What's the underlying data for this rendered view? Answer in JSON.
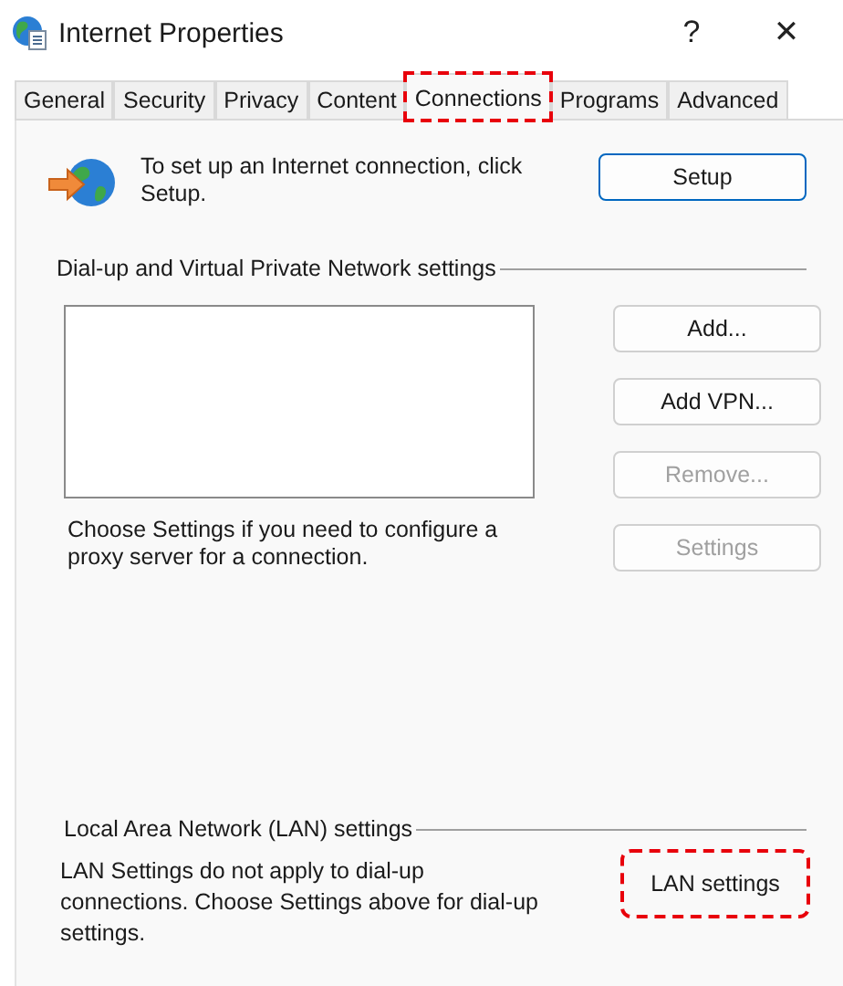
{
  "window": {
    "title": "Internet Properties",
    "help_button": "?",
    "close_button": "✕"
  },
  "tabs": [
    {
      "label": "General",
      "selected": false,
      "highlighted": false
    },
    {
      "label": "Security",
      "selected": false,
      "highlighted": false
    },
    {
      "label": "Privacy",
      "selected": false,
      "highlighted": false
    },
    {
      "label": "Content",
      "selected": false,
      "highlighted": false
    },
    {
      "label": "Connections",
      "selected": true,
      "highlighted": true
    },
    {
      "label": "Programs",
      "selected": false,
      "highlighted": false
    },
    {
      "label": "Advanced",
      "selected": false,
      "highlighted": false
    }
  ],
  "setup": {
    "text": "To set up an Internet connection, click Setup.",
    "button": {
      "label": "Setup",
      "focused": true
    }
  },
  "dialup": {
    "heading": "Dial-up and Virtual Private Network settings",
    "buttons": [
      {
        "label": "Add...",
        "disabled": false
      },
      {
        "label": "Add VPN...",
        "disabled": false
      },
      {
        "label": "Remove...",
        "disabled": true
      }
    ],
    "proxy_text": "Choose Settings if you need to configure a proxy server for a connection.",
    "settings_button": {
      "label": "Settings",
      "disabled": true
    }
  },
  "lan": {
    "heading": "Local Area Network (LAN) settings",
    "text": "LAN Settings do not apply to dial-up connections. Choose Settings above for dial-up settings.",
    "button": {
      "label": "LAN settings",
      "highlighted": true
    }
  }
}
